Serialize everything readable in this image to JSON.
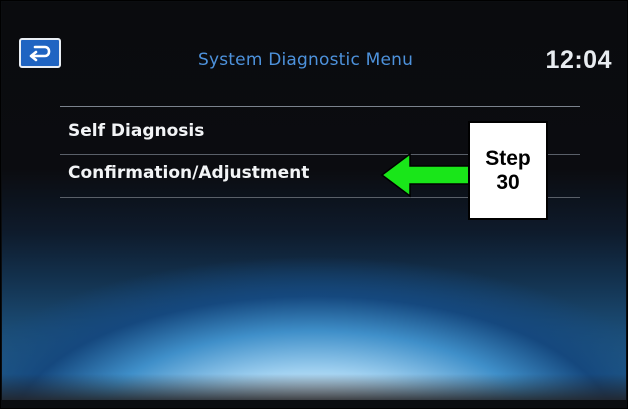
{
  "header": {
    "back_icon": "return-arrow-icon",
    "title": "System Diagnostic Menu",
    "clock": "12:04"
  },
  "menu": {
    "items": [
      {
        "label": "Self Diagnosis"
      },
      {
        "label": "Confirmation/Adjustment"
      }
    ]
  },
  "callout": {
    "arrow_icon": "green-left-arrow-icon",
    "arrow_color": "#19e619",
    "line1": "Step",
    "line2": "30"
  },
  "colors": {
    "title": "#4d92dc",
    "back_button": "#1f64c2",
    "menu_text": "#f2f4f6",
    "clock": "#e8ecf0"
  }
}
